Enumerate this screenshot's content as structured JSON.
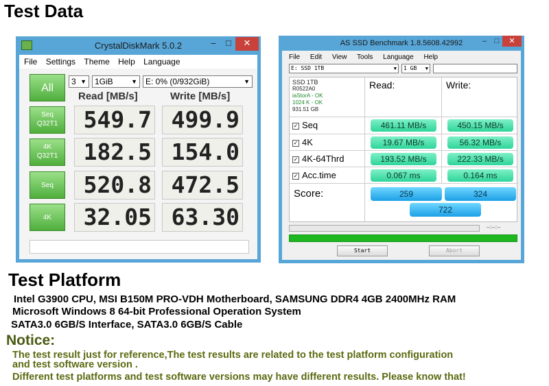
{
  "header": {
    "title": "Test Data"
  },
  "cdm": {
    "window_title": "CrystalDiskMark 5.0.2",
    "menu": [
      "File",
      "Settings",
      "Theme",
      "Help",
      "Language"
    ],
    "all_label": "All",
    "count": "3",
    "size": "1GiB",
    "drive": "E: 0% (0/932GiB)",
    "read_header": "Read [MB/s]",
    "write_header": "Write [MB/s]",
    "rows": [
      {
        "l1": "Seq",
        "l2": "Q32T1",
        "read": "549.7",
        "write": "499.9"
      },
      {
        "l1": "4K",
        "l2": "Q32T1",
        "read": "182.5",
        "write": "154.0"
      },
      {
        "l1": "Seq",
        "l2": "",
        "read": "520.8",
        "write": "472.5"
      },
      {
        "l1": "4K",
        "l2": "",
        "read": "32.05",
        "write": "63.30"
      }
    ]
  },
  "asssd": {
    "window_title": "AS SSD Benchmark 1.8.5608.42992",
    "menu": [
      "File",
      "Edit",
      "View",
      "Tools",
      "Language",
      "Help"
    ],
    "drive": "E: SSD 1TB",
    "size": "1 GB",
    "info": {
      "name": "SSD 1TB",
      "fw": "R0522A0",
      "driver": "iaStorA - OK",
      "align": "1024 K - OK",
      "capacity": "931.51 GB"
    },
    "read_header": "Read:",
    "write_header": "Write:",
    "rows": [
      {
        "label": "Seq",
        "read": "461.11 MB/s",
        "write": "450.15 MB/s"
      },
      {
        "label": "4K",
        "read": "19.67 MB/s",
        "write": "56.32 MB/s"
      },
      {
        "label": "4K-64Thrd",
        "read": "193.52 MB/s",
        "write": "222.33 MB/s"
      },
      {
        "label": "Acc.time",
        "read": "0.067 ms",
        "write": "0.164 ms"
      }
    ],
    "score_label": "Score:",
    "score_read": "259",
    "score_write": "324",
    "score_total": "722",
    "timer": "--:--:--",
    "start_label": "Start",
    "abort_label": "Abort"
  },
  "platform": {
    "title": "Test Platform",
    "lines": [
      "Intel G3900 CPU, MSI B150M PRO-VDH Motherboard, SAMSUNG DDR4 4GB 2400MHz RAM",
      "Microsoft Windows 8 64-bit Professional Operation System",
      "SATA3.0 6GB/S Interface,  SATA3.0 6GB/S Cable"
    ]
  },
  "notice": {
    "title": "Notice:",
    "lines": [
      "The test result just for reference,The test results are related to the test platform configuration",
      "and test software version .",
      "Different test platforms and test software versions may have different results. Please know that!"
    ]
  }
}
